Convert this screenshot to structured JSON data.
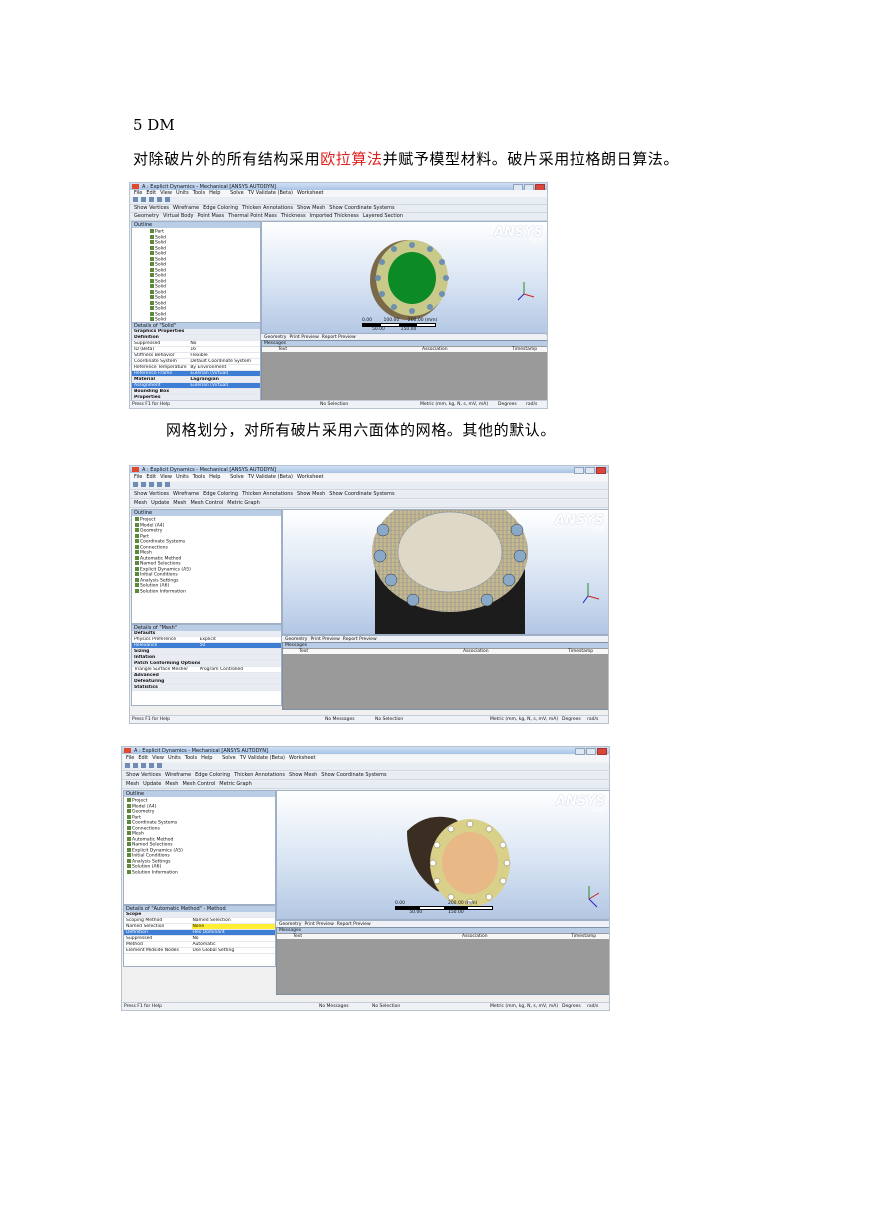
{
  "heading": "5 DM",
  "para1": {
    "before": "对除破片外的所有结构采用",
    "highlight": "欧拉算法",
    "after": "并赋予模型材料。破片采用拉格朗日算法。"
  },
  "para2": "网格划分，对所有破片采用六面体的网格。其他的默认。",
  "colors": {
    "highlight": "#e0201e",
    "ansys_yellow": "#ffee33",
    "selection": "#3d7dd4"
  },
  "app": {
    "title": "A : Explicit Dynamics - Mechanical [ANSYS AUTODYN]",
    "menu": [
      "File",
      "Edit",
      "View",
      "Units",
      "Tools",
      "Help"
    ],
    "toolbar1": [
      "Solve",
      "TV Validate (Beta)",
      "Worksheet"
    ],
    "toolbar2": [
      "Show Vertices",
      "Wireframe",
      "Edge Coloring",
      "Thicken Annotations",
      "Show Mesh",
      "Show Coordinate Systems"
    ],
    "logo": "ANSYS",
    "version": "14.0",
    "tabs": [
      "Geometry",
      "Print Preview",
      "Report Preview"
    ],
    "messages_title": "Messages",
    "msg_cols": [
      "Text",
      "Association",
      "Timestamp"
    ],
    "status": {
      "help": "Press F1 for Help",
      "messages": "No Messages",
      "selection": "No Selection",
      "units": "Metric (mm, kg, N, s, mV, mA)",
      "angle": "Degrees",
      "rate": "rad/s"
    }
  },
  "shot1": {
    "context": [
      "Geometry",
      "Virtual Body",
      "Point Mass",
      "Thermal Point Mass",
      "Thickness",
      "Imported Thickness",
      "Layered Section"
    ],
    "outline_title": "Outline",
    "tree": [
      "Part",
      "Solid",
      "Solid",
      "Solid",
      "Solid",
      "Solid",
      "Solid",
      "Solid",
      "Solid",
      "Solid",
      "Solid",
      "Solid",
      "Solid",
      "Solid",
      "Solid",
      "Solid",
      "Solid",
      "Solid",
      "Solid",
      "Solid"
    ],
    "details_title": "Details of \"Solid\"",
    "details": [
      {
        "k": "Graphics Properties",
        "v": "",
        "type": "grp"
      },
      {
        "k": "Definition",
        "v": "",
        "type": "grp"
      },
      {
        "k": "Suppressed",
        "v": "No",
        "type": ""
      },
      {
        "k": "ID (Beta)",
        "v": "16",
        "type": ""
      },
      {
        "k": "Stiffness Behavior",
        "v": "Flexible",
        "type": ""
      },
      {
        "k": "Coordinate System",
        "v": "Default Coordinate System",
        "type": ""
      },
      {
        "k": "Reference Temperature",
        "v": "By Environment",
        "type": ""
      },
      {
        "k": "Reference Frame",
        "v": "Eulerian (Virtual)",
        "type": "sel"
      },
      {
        "k": "Material",
        "v": "Lagrangian",
        "type": "grp"
      },
      {
        "k": "Assignment",
        "v": "Eulerian (Virtual)",
        "type": "sel"
      },
      {
        "k": "Bounding Box",
        "v": "",
        "type": "grp"
      },
      {
        "k": "Properties",
        "v": "",
        "type": "grp"
      },
      {
        "k": "Statistics",
        "v": "",
        "type": "grp"
      }
    ],
    "scale": {
      "a": "0.00",
      "b": "100.00",
      "c": "200.00 (mm)",
      "d": "50.00",
      "e": "150.00"
    }
  },
  "shot2": {
    "context": [
      "Mesh",
      "Update",
      "Mesh",
      "Mesh Control",
      "Metric Graph"
    ],
    "outline_title": "Outline",
    "tree": [
      "Project",
      "Model (A4)",
      "Geometry",
      "Part",
      "Coordinate Systems",
      "Connections",
      "Mesh",
      "Automatic Method",
      "Named Selections",
      "Explicit Dynamics (A5)",
      "Initial Conditions",
      "Analysis Settings",
      "Solution (A6)",
      "Solution Information"
    ],
    "details_title": "Details of \"Mesh\"",
    "details": [
      {
        "k": "Defaults",
        "v": "",
        "type": "grp"
      },
      {
        "k": "Physics Preference",
        "v": "Explicit",
        "type": ""
      },
      {
        "k": "Relevance",
        "v": "50",
        "type": "sel"
      },
      {
        "k": "Sizing",
        "v": "",
        "type": "grp"
      },
      {
        "k": "Inflation",
        "v": "",
        "type": "grp"
      },
      {
        "k": "Patch Conforming Options",
        "v": "",
        "type": "grp"
      },
      {
        "k": "Triangle Surface Mesher",
        "v": "Program Controlled",
        "type": ""
      },
      {
        "k": "Advanced",
        "v": "",
        "type": "grp"
      },
      {
        "k": "Defeaturing",
        "v": "",
        "type": "grp"
      },
      {
        "k": "Statistics",
        "v": "",
        "type": "grp"
      }
    ]
  },
  "shot3": {
    "context": [
      "Mesh",
      "Update",
      "Mesh",
      "Mesh Control",
      "Metric Graph"
    ],
    "outline_title": "Outline",
    "tree": [
      "Project",
      "Model (A4)",
      "Geometry",
      "Part",
      "Coordinate Systems",
      "Connections",
      "Mesh",
      "Automatic Method",
      "Named Selections",
      "Explicit Dynamics (A5)",
      "Initial Conditions",
      "Analysis Settings",
      "Solution (A6)",
      "Solution Information"
    ],
    "details_title": "Details of \"Automatic Method\" - Method",
    "details": [
      {
        "k": "Scope",
        "v": "",
        "type": "grp"
      },
      {
        "k": "Scoping Method",
        "v": "Named Selection",
        "type": ""
      },
      {
        "k": "Named Selection",
        "v": "None",
        "type": "yel"
      },
      {
        "k": "Definition",
        "v": "Hex Dominant",
        "type": "sel"
      },
      {
        "k": "Suppressed",
        "v": "No",
        "type": ""
      },
      {
        "k": "Method",
        "v": "Automatic",
        "type": ""
      },
      {
        "k": "Element Midside Nodes",
        "v": "Use Global Setting",
        "type": ""
      }
    ],
    "scale": {
      "a": "0.00",
      "b": "200.00 (mm)",
      "c": "50.00",
      "d": "150.00"
    }
  }
}
